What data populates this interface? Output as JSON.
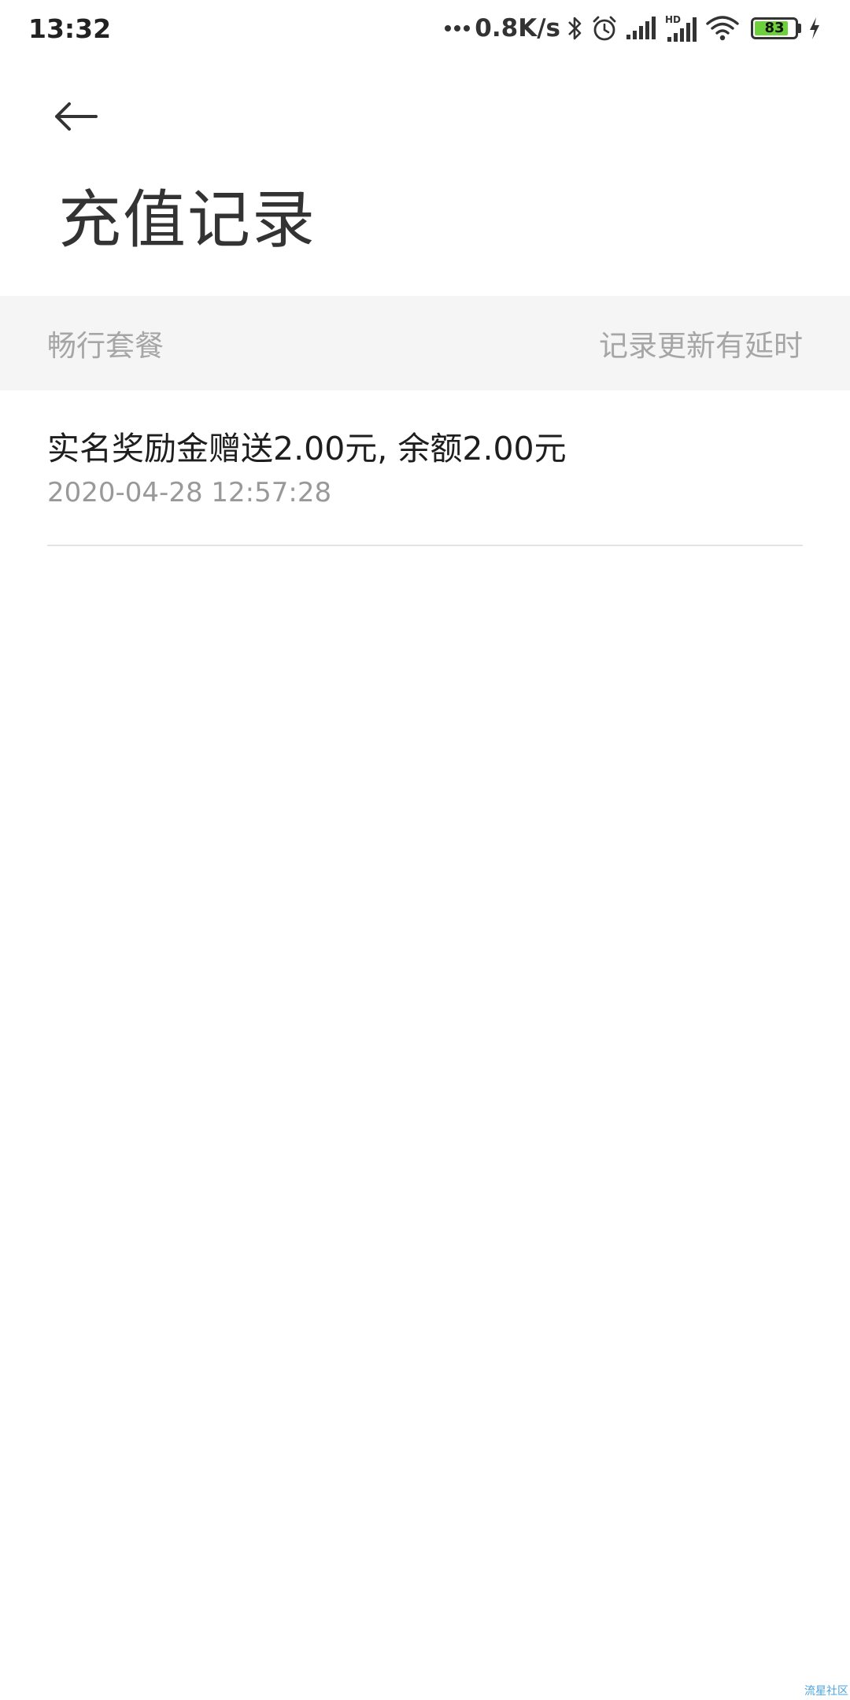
{
  "status_bar": {
    "time": "13:32",
    "network_speed": "0.8K/s",
    "battery_level": "83",
    "battery_percent": 83,
    "icons": [
      "dots-icon",
      "bluetooth-icon",
      "alarm-icon",
      "signal-icon",
      "hd-signal-icon",
      "wifi-icon",
      "battery-icon",
      "charging-icon"
    ],
    "signal_hd_label": "HD"
  },
  "header": {
    "back_icon": "back-arrow-icon",
    "title": "充值记录"
  },
  "section": {
    "left_label": "畅行套餐",
    "right_label": "记录更新有延时"
  },
  "records": [
    {
      "description": "实名奖励金赠送2.00元, 余额2.00元",
      "timestamp": "2020-04-28 12:57:28"
    }
  ],
  "watermark": "流星社区",
  "colors": {
    "section_bg": "#f5f5f5",
    "muted_text": "#a6a6a6",
    "battery_green": "#6cd13a",
    "divider": "#e3e3e3"
  }
}
